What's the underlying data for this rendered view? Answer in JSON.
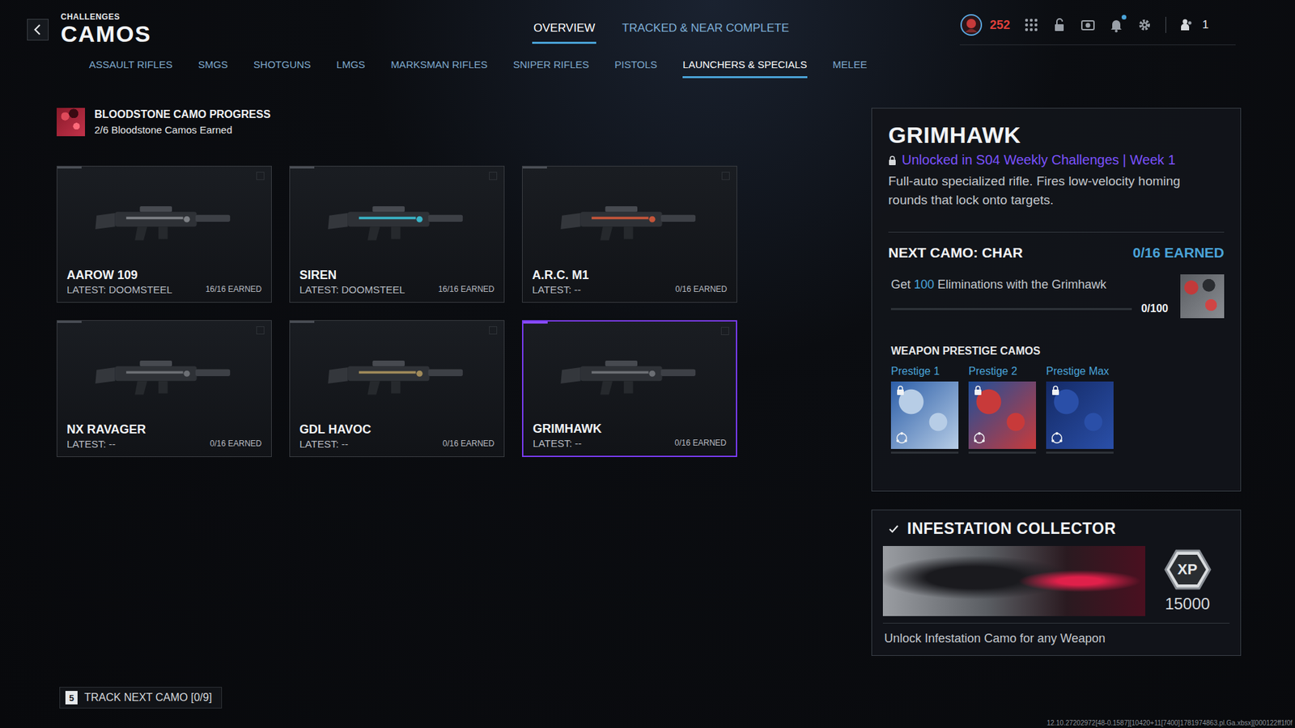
{
  "header": {
    "section": "CHALLENGES",
    "title": "CAMOS"
  },
  "nav": [
    {
      "label": "OVERVIEW",
      "selected": true
    },
    {
      "label": "TRACKED & NEAR COMPLETE",
      "selected": false
    }
  ],
  "status": {
    "level": "252",
    "party_count": "1",
    "notification": true
  },
  "categories": [
    {
      "label": "ASSAULT RIFLES",
      "selected": false
    },
    {
      "label": "SMGS",
      "selected": false
    },
    {
      "label": "SHOTGUNS",
      "selected": false
    },
    {
      "label": "LMGS",
      "selected": false
    },
    {
      "label": "MARKSMAN RIFLES",
      "selected": false
    },
    {
      "label": "SNIPER RIFLES",
      "selected": false
    },
    {
      "label": "PISTOLS",
      "selected": false
    },
    {
      "label": "LAUNCHERS & SPECIALS",
      "selected": true
    },
    {
      "label": "MELEE",
      "selected": false
    }
  ],
  "bloodstone": {
    "title": "BLOODSTONE CAMO PROGRESS",
    "progress": "2/6 Bloodstone Camos Earned"
  },
  "weapons": [
    {
      "name": "AAROW 109",
      "latest": "LATEST: DOOMSTEEL",
      "earned": "16/16 EARNED",
      "selected": false,
      "color": "#7c7f84"
    },
    {
      "name": "SIREN",
      "latest": "LATEST: DOOMSTEEL",
      "earned": "16/16 EARNED",
      "selected": false,
      "color": "#39b3c6"
    },
    {
      "name": "A.R.C. M1",
      "latest": "LATEST: --",
      "earned": "0/16 EARNED",
      "selected": false,
      "color": "#c4553a"
    },
    {
      "name": "NX RAVAGER",
      "latest": "LATEST: --",
      "earned": "0/16 EARNED",
      "selected": false,
      "color": "#6c6f74"
    },
    {
      "name": "GDL HAVOC",
      "latest": "LATEST: --",
      "earned": "0/16 EARNED",
      "selected": false,
      "color": "#a08a5a"
    },
    {
      "name": "GRIMHAWK",
      "latest": "LATEST: --",
      "earned": "0/16 EARNED",
      "selected": true,
      "color": "#6c6f74"
    }
  ],
  "detail": {
    "name": "GRIMHAWK",
    "unlock": "Unlocked in S04 Weekly Challenges | Week 1",
    "locked": true,
    "description": "Full-auto specialized rifle. Fires low-velocity homing rounds that lock onto targets.",
    "next_camo": "NEXT CAMO: CHAR",
    "earned": "0/16 EARNED",
    "challenge": {
      "prefix": "Get ",
      "count": "100",
      "suffix": " Eliminations with the Grimhawk",
      "progress": "0/100",
      "level": 0
    },
    "prestige_title": "WEAPON PRESTIGE CAMOS",
    "prestige": [
      {
        "label": "Prestige 1",
        "locked": true,
        "colors": [
          "#b7cde6",
          "#2c5ea8"
        ]
      },
      {
        "label": "Prestige 2",
        "locked": true,
        "colors": [
          "#c83a3a",
          "#1f4f9a"
        ]
      },
      {
        "label": "Prestige Max",
        "locked": true,
        "colors": [
          "#2a4fa8",
          "#142a66"
        ]
      }
    ]
  },
  "reward": {
    "title": "INFESTATION COLLECTOR",
    "checked": true,
    "xp_badge": "XP",
    "xp": "15000",
    "description": "Unlock Infestation Camo for any Weapon"
  },
  "track": {
    "key": "5",
    "label": "TRACK NEXT CAMO [0/9]"
  },
  "build": "12.10.27202972[48-0.1587][10420+11[7400]1781974863.pl.Ga.xbsx][000122ff1f0f"
}
